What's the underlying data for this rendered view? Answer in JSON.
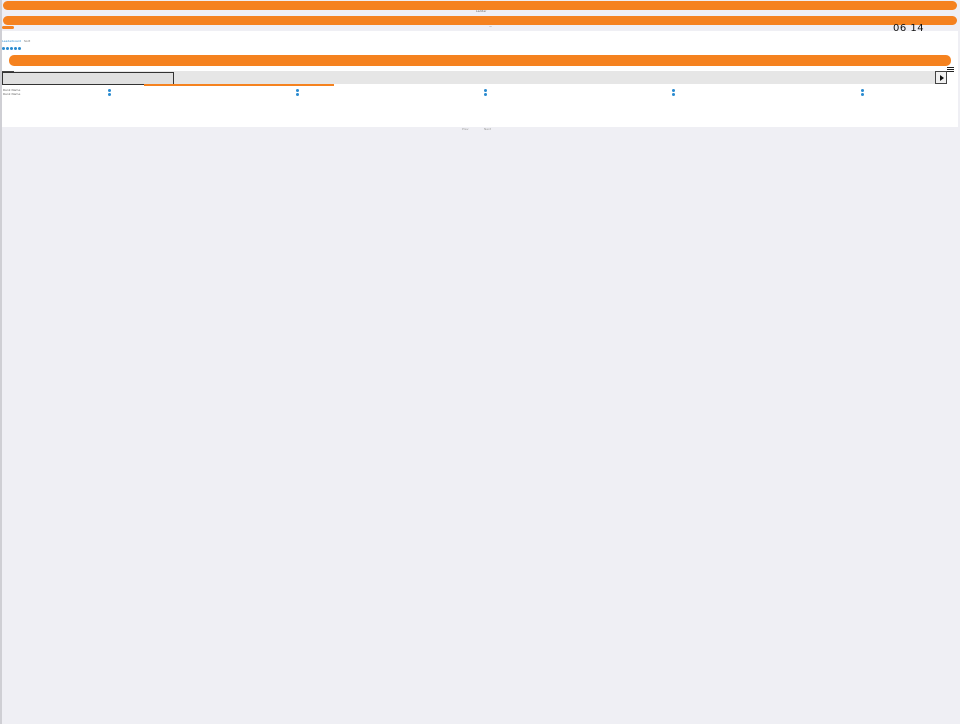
{
  "header": {
    "title": "Ladder",
    "subtitle": "ー",
    "time": "06 14"
  },
  "meta": {
    "line1": "Leaderboard",
    "line2": "Sort",
    "row1": "Rank  Name",
    "row2": "Rank  Name"
  },
  "footer": {
    "left": "Prev",
    "right": "Next"
  },
  "colors": {
    "accent": "#f5821f",
    "link": "#2a8bd0"
  }
}
